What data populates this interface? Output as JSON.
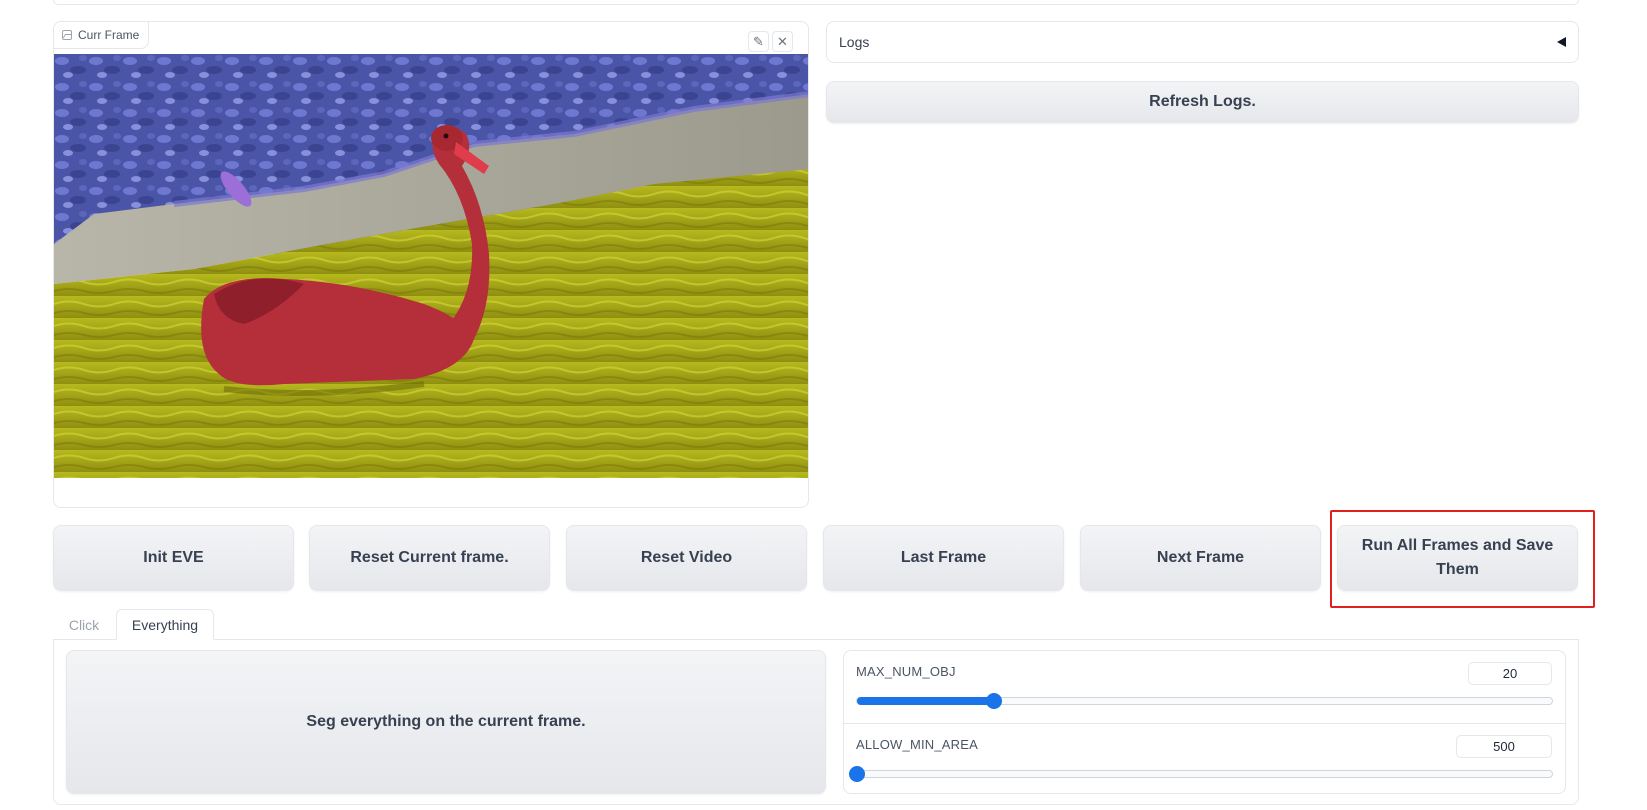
{
  "image_panel": {
    "label": "Curr Frame",
    "edit_icon": "pencil-icon",
    "close_icon": "close-icon"
  },
  "logs": {
    "label": "Logs",
    "toggle_icon": "collapse-left-icon",
    "refresh_label": "Refresh Logs."
  },
  "actions": [
    {
      "label": "Init EVE"
    },
    {
      "label": "Reset Current frame."
    },
    {
      "label": "Reset Video"
    },
    {
      "label": "Last Frame"
    },
    {
      "label": "Next Frame"
    },
    {
      "label": "Run All Frames and Save Them"
    }
  ],
  "tabs": [
    {
      "label": "Click",
      "selected": false
    },
    {
      "label": "Everything",
      "selected": true
    }
  ],
  "everything": {
    "seg_label": "Seg everything on the current frame.",
    "max_num_obj": {
      "label": "MAX_NUM_OBJ",
      "value": "20",
      "fraction": 0.197
    },
    "allow_min_area": {
      "label": "ALLOW_MIN_AREA",
      "value": "500",
      "fraction": 0.0
    }
  },
  "colors": {
    "accent": "#1a73e8",
    "highlight": "#e02020",
    "mask_object": "#c8323c",
    "mask_water": "#c8c80a",
    "mask_foliage": "#5a5ad2"
  }
}
